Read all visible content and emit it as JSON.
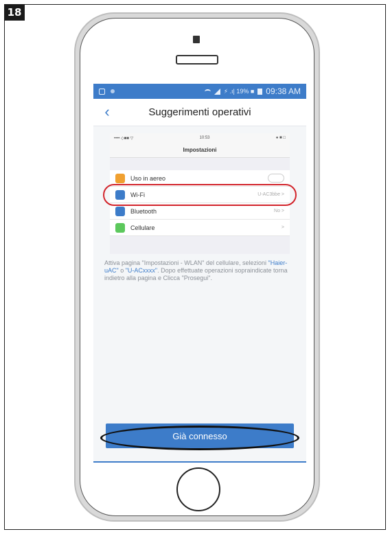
{
  "step_number": "18",
  "status_bar": {
    "indicators": "⚡ .ı| 19% ■",
    "time": "09:38 AM"
  },
  "header": {
    "back_icon": "chevron-left-icon",
    "title": "Suggerimenti operativi"
  },
  "ios_screenshot": {
    "status_left": "•••• ◇■■ ▽",
    "status_center": "10:53",
    "status_right": "● ■ □",
    "title": "Impostazioni",
    "rows": [
      {
        "label": "Uso in aereo",
        "value": "",
        "icon_color": "#f0a030",
        "control": "toggle"
      },
      {
        "label": "Wi-Fi",
        "value": "U-AC3bbe  >",
        "icon_color": "#3d7cc9",
        "control": "value"
      },
      {
        "label": "Bluetooth",
        "value": "No  >",
        "icon_color": "#3d7cc9",
        "control": "value"
      },
      {
        "label": "Cellulare",
        "value": ">",
        "icon_color": "#5cc85c",
        "control": "value"
      }
    ]
  },
  "instructions": {
    "part1": "Attiva pagina \"Impostazioni - WLAN\" del cellulare, selezioni ",
    "highlight1": "\"Haier-uAC\"",
    "part2": " o ",
    "highlight2": "\"U-ACxxxx\"",
    "part3": ". Dopo effettuate operazioni sopraindicate torna indietro alla pagina e Clicca \"Prosegui\"."
  },
  "primary_button": {
    "label": "Già connesso"
  },
  "colors": {
    "accent": "#3d7cc9",
    "highlight_red": "#d2232a",
    "annotation_black": "#111111"
  }
}
